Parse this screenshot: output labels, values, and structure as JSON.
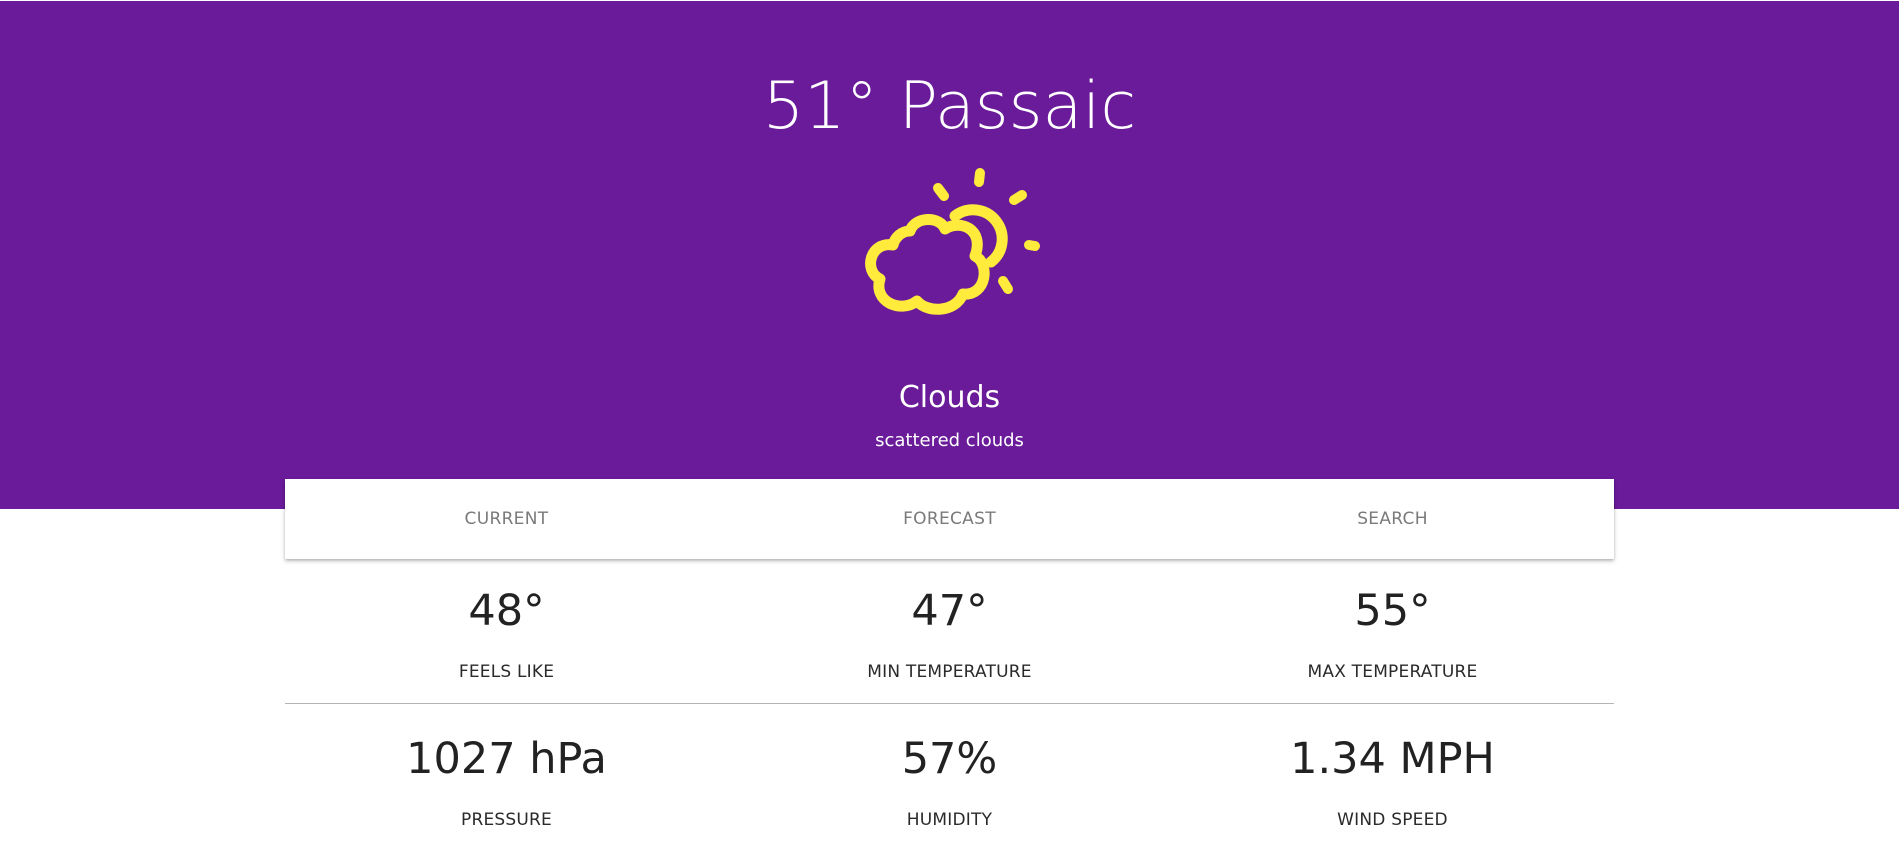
{
  "header": {
    "title": "51° Passaic",
    "condition": "Clouds",
    "description": "scattered clouds",
    "icon": "partly-cloudy-icon",
    "background_color": "#6a1b9a",
    "icon_color": "#ffeb3b"
  },
  "tabs": [
    {
      "label": "CURRENT"
    },
    {
      "label": "FORECAST"
    },
    {
      "label": "SEARCH"
    }
  ],
  "stats": {
    "feels_like": {
      "value": "48°",
      "label": "FEELS LIKE"
    },
    "min_temp": {
      "value": "47°",
      "label": "MIN TEMPERATURE"
    },
    "max_temp": {
      "value": "55°",
      "label": "MAX TEMPERATURE"
    },
    "pressure": {
      "value": "1027 hPa",
      "label": "PRESSURE"
    },
    "humidity": {
      "value": "57%",
      "label": "HUMIDITY"
    },
    "wind_speed": {
      "value": "1.34 MPH",
      "label": "WIND SPEED"
    }
  }
}
